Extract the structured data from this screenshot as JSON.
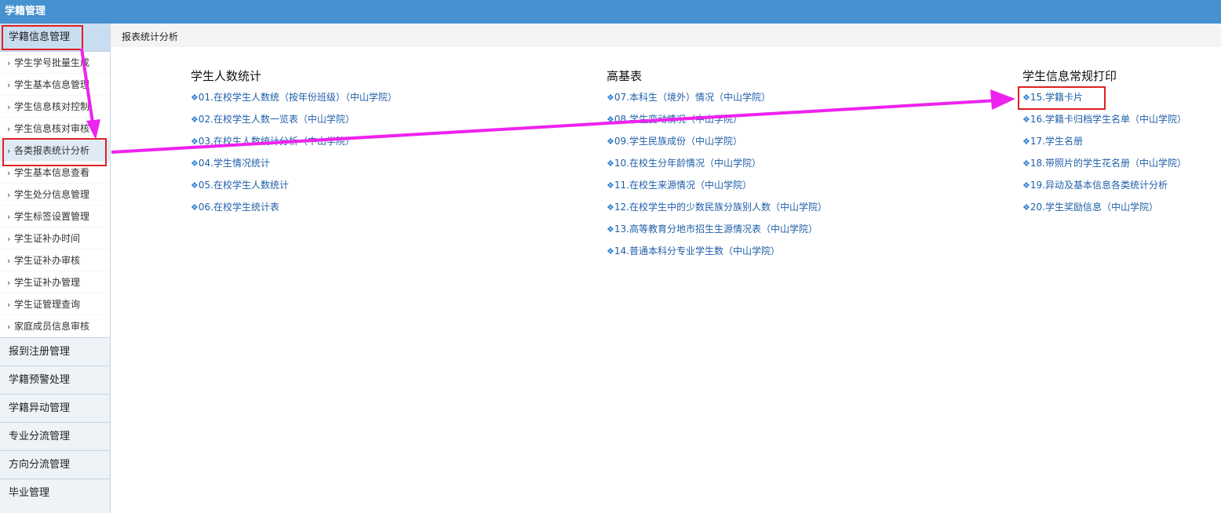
{
  "app": {
    "title": "学籍管理"
  },
  "sidebar": {
    "header": "学籍信息管理",
    "items": [
      {
        "label": "学生学号批量生成"
      },
      {
        "label": "学生基本信息管理"
      },
      {
        "label": "学生信息核对控制"
      },
      {
        "label": "学生信息核对审核"
      },
      {
        "label": "各类报表统计分析"
      },
      {
        "label": "学生基本信息查看"
      },
      {
        "label": "学生处分信息管理"
      },
      {
        "label": "学生标签设置管理"
      },
      {
        "label": "学生证补办时间"
      },
      {
        "label": "学生证补办审核"
      },
      {
        "label": "学生证补办管理"
      },
      {
        "label": "学生证管理查询"
      },
      {
        "label": "家庭成员信息审核"
      }
    ],
    "active_index": 4,
    "groups": [
      {
        "label": "报到注册管理"
      },
      {
        "label": "学籍预警处理"
      },
      {
        "label": "学籍异动管理"
      },
      {
        "label": "专业分流管理"
      },
      {
        "label": "方向分流管理"
      },
      {
        "label": "毕业管理"
      }
    ]
  },
  "breadcrumb": "报表统计分析",
  "columns": [
    {
      "title": "学生人数统计",
      "links": [
        "01.在校学生人数统（按年份班级）（中山学院）",
        "02.在校学生人数一览表（中山学院）",
        "03.在校生人数统计分析（中山学院）",
        "04.学生情况统计",
        "05.在校学生人数统计",
        "06.在校学生统计表"
      ]
    },
    {
      "title": "高基表",
      "links": [
        "07.本科生（境外）情况（中山学院）",
        "08.学生变动情况（中山学院）",
        "09.学生民族成份（中山学院）",
        "10.在校生分年龄情况（中山学院）",
        "11.在校生来源情况（中山学院）",
        "12.在校学生中的少数民族分族别人数（中山学院）",
        "13.高等教育分地市招生生源情况表（中山学院）",
        "14.普通本科分专业学生数（中山学院）"
      ]
    },
    {
      "title": "学生信息常规打印",
      "links": [
        "15.学籍卡片",
        "16.学籍卡归档学生名单（中山学院）",
        "17.学生名册",
        "18.带照片的学生花名册（中山学院）",
        "19.异动及基本信息各类统计分析",
        "20.学生奖励信息（中山学院）"
      ]
    }
  ],
  "link_bullet": "❖",
  "sidebar_caret": "›",
  "colors": {
    "topbar": "#4691cf",
    "link": "#1f5fa8",
    "highlight_box": "#e02020",
    "annotation_arrow": "#ee22ee"
  }
}
